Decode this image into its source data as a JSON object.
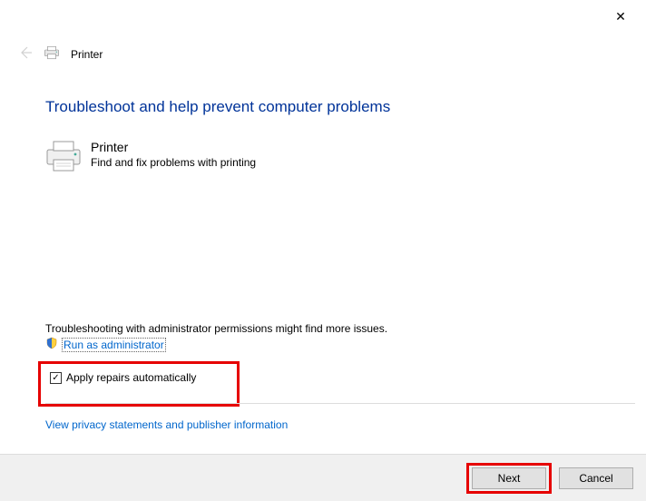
{
  "window": {
    "close_icon": "✕"
  },
  "header": {
    "title": "Printer"
  },
  "main": {
    "page_title": "Troubleshoot and help prevent computer problems",
    "section_title": "Printer",
    "section_desc": "Find and fix problems with printing"
  },
  "admin": {
    "note": "Troubleshooting with administrator permissions might find more issues.",
    "link": "Run as administrator"
  },
  "checkbox": {
    "label": "Apply repairs automatically",
    "checked": true
  },
  "privacy": {
    "link": "View privacy statements and publisher information"
  },
  "footer": {
    "next": "Next",
    "cancel": "Cancel"
  }
}
